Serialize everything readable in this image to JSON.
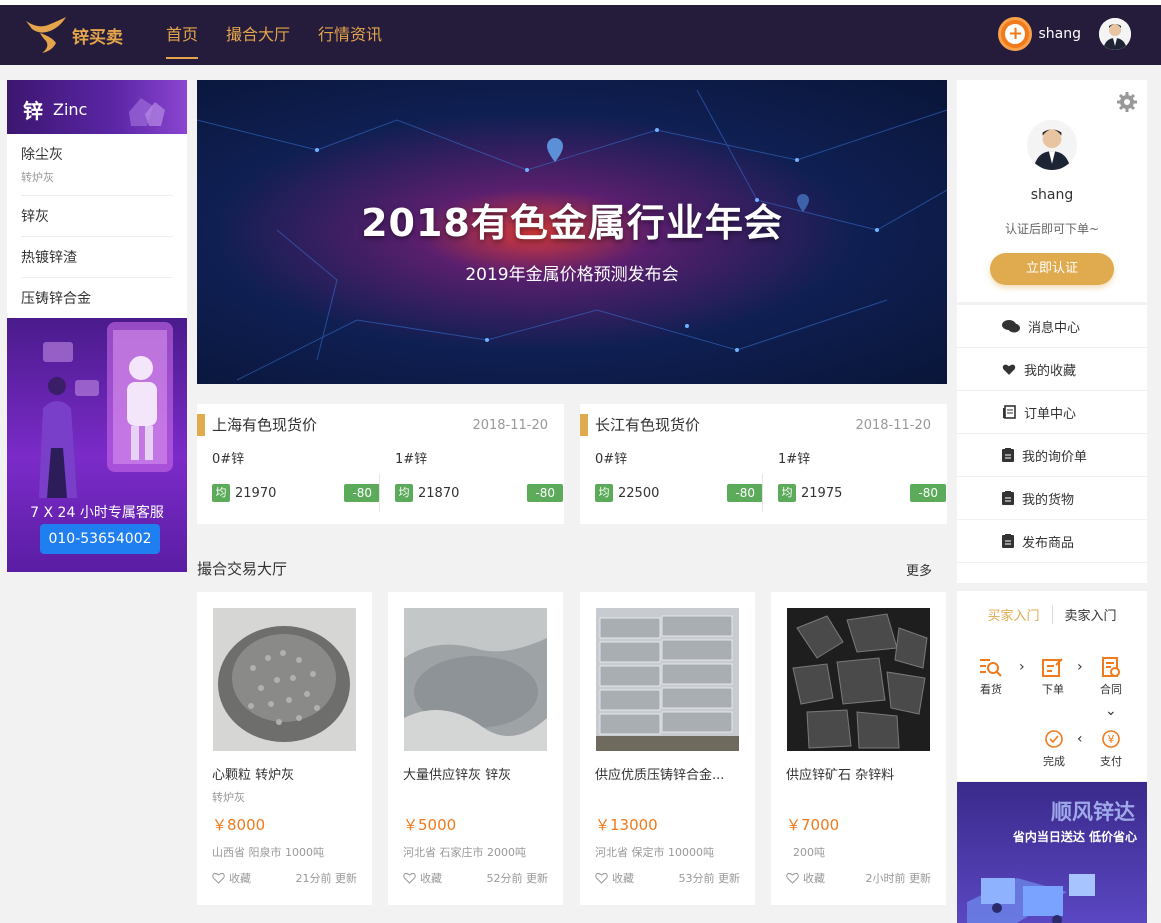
{
  "header": {
    "logo_text": "锌买卖",
    "nav": [
      "首页",
      "撮合大厅",
      "行情资讯"
    ],
    "username": "shang"
  },
  "left": {
    "zinc_big": "锌",
    "zinc_en": "Zinc",
    "categories": [
      {
        "title": "除尘灰",
        "sub": "转炉灰"
      },
      {
        "title": "锌灰"
      },
      {
        "title": "热镀锌渣"
      },
      {
        "title": "压铸锌合金"
      }
    ],
    "ad_service": "7 X 24 小时专属客服",
    "ad_phone": "010-53654002"
  },
  "banner": {
    "title": "2018有色金属行业年会",
    "subtitle": "2019年金属价格预测发布会"
  },
  "prices": [
    {
      "title": "上海有色现货价",
      "date": "2018-11-20",
      "items": [
        {
          "name": "0#锌",
          "badge": "均",
          "value": "21970",
          "change": "-80"
        },
        {
          "name": "1#锌",
          "badge": "均",
          "value": "21870",
          "change": "-80"
        }
      ]
    },
    {
      "title": "长江有色现货价",
      "date": "2018-11-20",
      "items": [
        {
          "name": "0#锌",
          "badge": "均",
          "value": "22500",
          "change": "-80"
        },
        {
          "name": "1#锌",
          "badge": "均",
          "value": "21975",
          "change": "-80"
        }
      ]
    }
  ],
  "hall": {
    "title": "撮合交易大厅",
    "more": "更多",
    "products": [
      {
        "name": "心颗粒 转炉灰",
        "sub": "转炉灰",
        "price": "￥8000",
        "loc": "山西省 阳泉市  1000吨",
        "fav": "收藏",
        "updated": "21分前 更新"
      },
      {
        "name": "大量供应锌灰 锌灰",
        "sub": "",
        "price": "￥5000",
        "loc": "河北省 石家庄市  2000吨",
        "fav": "收藏",
        "updated": "52分前 更新"
      },
      {
        "name": "供应优质压铸锌合金...",
        "sub": "",
        "price": "￥13000",
        "loc": "河北省 保定市  10000吨",
        "fav": "收藏",
        "updated": "53分前 更新"
      },
      {
        "name": "供应锌矿石 杂锌料",
        "sub": "",
        "price": "￥7000",
        "loc": "200吨",
        "fav": "收藏",
        "updated": "2小时前 更新"
      }
    ]
  },
  "profile": {
    "name": "shang",
    "tip": "认证后即可下单~",
    "button": "立即认证"
  },
  "menu": [
    "消息中心",
    "我的收藏",
    "订单中心",
    "我的询价单",
    "我的货物",
    "发布商品"
  ],
  "flow": {
    "tab_buyer": "买家入门",
    "tab_seller": "卖家入门",
    "steps": [
      "看货",
      "下单",
      "合同",
      "完成",
      "支付"
    ]
  },
  "ad_right": {
    "title": "顺风锌达",
    "sub": "省内当日送达 低价省心"
  },
  "colors": {
    "header_bg": "#241c3a",
    "accent": "#e3a44b",
    "price": "#f07a1c",
    "green": "#5bab5b"
  }
}
